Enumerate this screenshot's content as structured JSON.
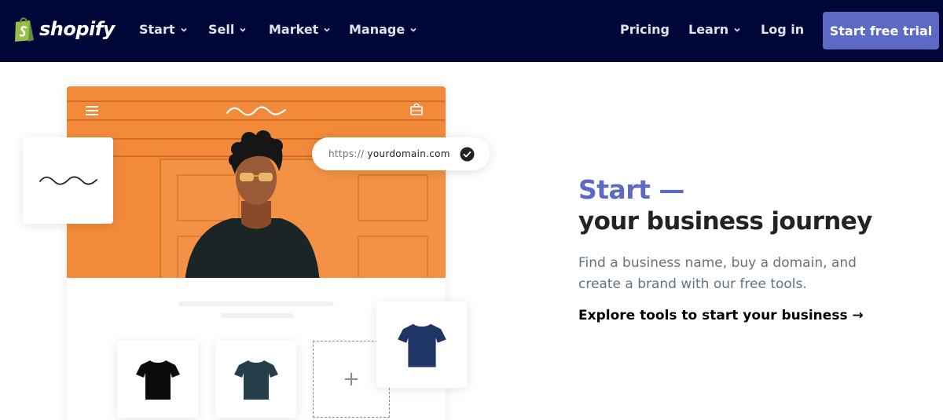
{
  "nav": {
    "logo_text": "shopify",
    "items": [
      {
        "label": "Start",
        "has_dropdown": true
      },
      {
        "label": "Sell",
        "has_dropdown": true
      },
      {
        "label": "Market",
        "has_dropdown": true
      },
      {
        "label": "Manage",
        "has_dropdown": true
      }
    ],
    "right_items": [
      {
        "label": "Pricing",
        "has_dropdown": false
      },
      {
        "label": "Learn",
        "has_dropdown": true
      },
      {
        "label": "Log in",
        "has_dropdown": false
      }
    ],
    "cta_label": "Start free trial"
  },
  "illustration": {
    "domain_prefix": "https://",
    "domain_name": "yourdomain.com",
    "icons": [
      "hamburger-menu-icon",
      "wave-logo-icon",
      "shopping-bag-icon",
      "checkmark-icon",
      "plus-icon"
    ],
    "products": [
      "black-tshirt",
      "teal-tshirt",
      "navy-tshirt"
    ]
  },
  "hero_text": {
    "headline_accent": "Start —",
    "headline": "your business journey",
    "description": "Find a business name, buy a domain, and create a brand with our free tools.",
    "link_label": "Explore tools to start your business →"
  },
  "colors": {
    "nav_bg": "#000638",
    "accent": "#5c6ac4",
    "hero_orange": "#f28a3a",
    "logo_green": "#95bf47"
  }
}
